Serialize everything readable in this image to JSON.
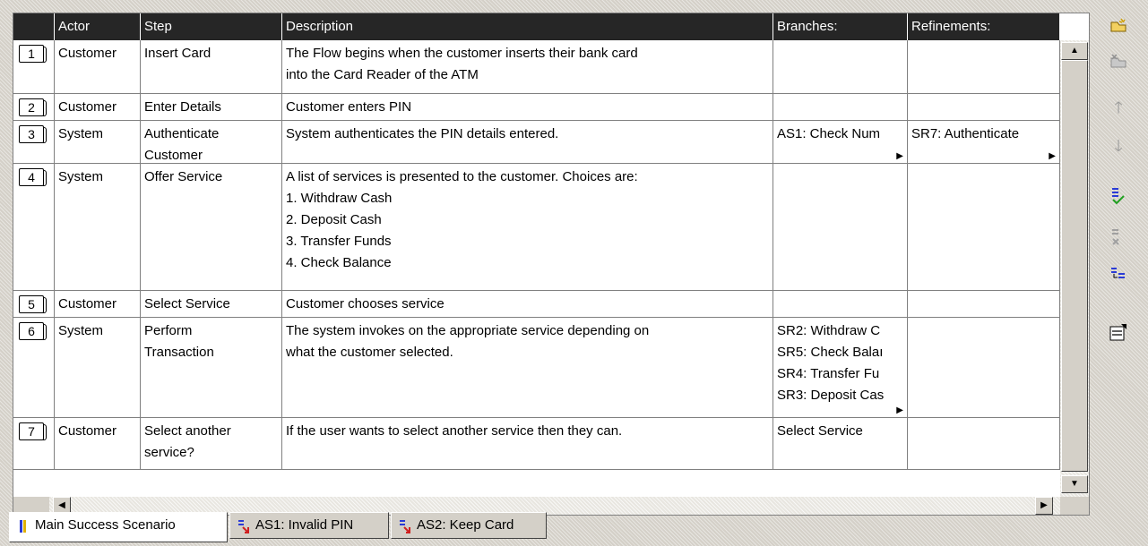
{
  "columns": [
    "Actor",
    "Step",
    "Description",
    "Branches:",
    "Refinements:"
  ],
  "rows": [
    {
      "num": "1",
      "actor": "Customer",
      "step": "Insert Card",
      "description": "The Flow begins when the customer inserts their bank card\ninto the Card Reader of the ATM",
      "branches": "",
      "refinements": "",
      "branches_more": false,
      "refinements_more": false
    },
    {
      "num": "2",
      "actor": "Customer",
      "step": "Enter Details",
      "description": "Customer enters PIN",
      "branches": "",
      "refinements": "",
      "branches_more": false,
      "refinements_more": false
    },
    {
      "num": "3",
      "actor": "System",
      "step": "Authenticate\nCustomer",
      "description": "System authenticates the PIN details entered.",
      "branches": "AS1: Check Num",
      "refinements": "SR7: Authenticate",
      "branches_more": true,
      "refinements_more": true
    },
    {
      "num": "4",
      "actor": "System",
      "step": "Offer Service",
      "description": "A list of services is presented to the customer. Choices are:\n1. Withdraw Cash\n2. Deposit Cash\n3. Transfer Funds\n4. Check Balance",
      "branches": "",
      "refinements": "",
      "branches_more": false,
      "refinements_more": false
    },
    {
      "num": "5",
      "actor": "Customer",
      "step": "Select Service",
      "description": "Customer chooses service",
      "branches": "",
      "refinements": "",
      "branches_more": false,
      "refinements_more": false
    },
    {
      "num": "6",
      "actor": "System",
      "step": "Perform\nTransaction",
      "description": "The system invokes on the appropriate service depending on\nwhat the customer selected.",
      "branches": "SR2: Withdraw C\nSR5: Check Balaı\nSR4: Transfer Fu\nSR3: Deposit Cas",
      "refinements": "",
      "branches_more": true,
      "refinements_more": false
    },
    {
      "num": "7",
      "actor": "Customer",
      "step": "Select another\nservice?",
      "description": "If the user wants to select another service then they can.",
      "branches": "Select Service",
      "refinements": "",
      "branches_more": false,
      "refinements_more": false
    }
  ],
  "tabs": [
    {
      "label": "Main Success Scenario",
      "active": true
    },
    {
      "label": "AS1: Invalid PIN",
      "active": false
    },
    {
      "label": "AS2: Keep Card",
      "active": false
    }
  ],
  "toolbar": {
    "icons": [
      "new-step-icon",
      "delete-step-icon",
      "move-up-icon",
      "move-down-icon",
      "add-branch-icon",
      "remove-branch-icon",
      "add-refinement-icon",
      "properties-icon"
    ]
  },
  "colors": {
    "header_bg": "#262626",
    "header_text": "#ffffff",
    "grid_line": "#808080",
    "panel": "#d4d0c8"
  }
}
